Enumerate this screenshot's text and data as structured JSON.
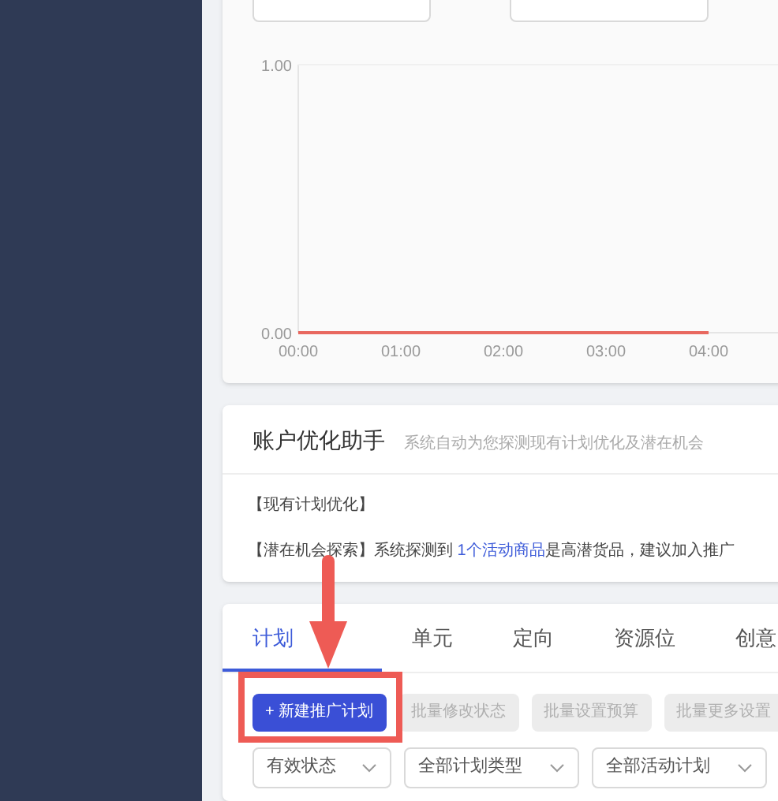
{
  "trend_chart": {
    "chart_data": {
      "type": "line",
      "categories": [
        "00:00",
        "01:00",
        "02:00",
        "03:00",
        "04:00"
      ],
      "series": [
        {
          "color": "#e8685f",
          "values": [
            0,
            0,
            0,
            0,
            0
          ]
        }
      ],
      "ylim": [
        0,
        1
      ],
      "yticks": [
        {
          "value": 1,
          "label": "1.00"
        },
        {
          "value": 0,
          "label": "0.00"
        }
      ]
    }
  },
  "assistant": {
    "title": "账户优化助手",
    "subtitle": "系统自动为您探测现有计划优化及潜在机会",
    "items": [
      {
        "text": "【现有计划优化】"
      },
      {
        "prefix": "【潜在机会探索】系统探测到 ",
        "link": "1个活动商品",
        "suffix": "是高潜货品，建议加入推广"
      }
    ]
  },
  "tabs": [
    {
      "label": "计划",
      "selected": true
    },
    {
      "label": "单元",
      "selected": false
    },
    {
      "label": "定向",
      "selected": false
    },
    {
      "label": "资源位",
      "selected": false
    },
    {
      "label": "创意",
      "selected": false
    }
  ],
  "actions": [
    {
      "label": "+ 新建推广计划",
      "kind": "primary",
      "disabled": false
    },
    {
      "label": "批量修改状态",
      "kind": "secondary",
      "disabled": true
    },
    {
      "label": "批量设置预算",
      "kind": "secondary",
      "disabled": true
    },
    {
      "label": "批量更多设置",
      "kind": "secondary",
      "disabled": true
    }
  ],
  "filters": [
    {
      "value": "有效状态"
    },
    {
      "value": "全部计划类型"
    },
    {
      "value": "全部活动计划"
    }
  ]
}
